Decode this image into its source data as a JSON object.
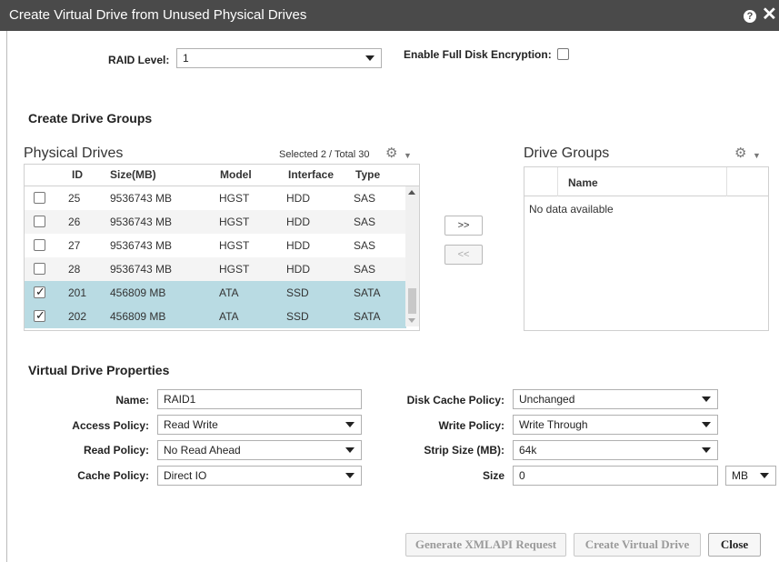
{
  "window": {
    "title": "Create Virtual Drive from Unused Physical Drives",
    "help_icon": "?",
    "close_icon": "✕"
  },
  "raid": {
    "label": "RAID Level:",
    "value": "1"
  },
  "encryption": {
    "label": "Enable Full Disk Encryption:",
    "checked": false
  },
  "create_groups": {
    "title": "Create Drive Groups"
  },
  "physical": {
    "title": "Physical Drives",
    "selected_text": "Selected 2 / Total 30",
    "columns": [
      "ID",
      "Size(MB)",
      "Model",
      "Interface",
      "Type"
    ],
    "rows": [
      {
        "id": "25",
        "size": "9536743 MB",
        "model": "HGST",
        "interface": "HDD",
        "type": "SAS",
        "checked": false
      },
      {
        "id": "26",
        "size": "9536743 MB",
        "model": "HGST",
        "interface": "HDD",
        "type": "SAS",
        "checked": false
      },
      {
        "id": "27",
        "size": "9536743 MB",
        "model": "HGST",
        "interface": "HDD",
        "type": "SAS",
        "checked": false
      },
      {
        "id": "28",
        "size": "9536743 MB",
        "model": "HGST",
        "interface": "HDD",
        "type": "SAS",
        "checked": false
      },
      {
        "id": "201",
        "size": "456809 MB",
        "model": "ATA",
        "interface": "SSD",
        "type": "SATA",
        "checked": true
      },
      {
        "id": "202",
        "size": "456809 MB",
        "model": "ATA",
        "interface": "SSD",
        "type": "SATA",
        "checked": true
      }
    ]
  },
  "move": {
    "add_label": ">>",
    "remove_label": "<<"
  },
  "drive_groups": {
    "title": "Drive Groups",
    "column": "Name",
    "empty_text": "No data available"
  },
  "vd_props": {
    "title": "Virtual Drive Properties",
    "name_label": "Name:",
    "name_value": "RAID1",
    "access_label": "Access Policy:",
    "access_value": "Read Write",
    "read_label": "Read Policy:",
    "read_value": "No Read Ahead",
    "cache_label": "Cache Policy:",
    "cache_value": "Direct IO",
    "disk_cache_label": "Disk Cache Policy:",
    "disk_cache_value": "Unchanged",
    "write_label": "Write Policy:",
    "write_value": "Write Through",
    "strip_label": "Strip Size (MB):",
    "strip_value": "64k",
    "size_label": "Size",
    "size_value": "0",
    "size_unit": "MB"
  },
  "buttons": {
    "xmlapi": "Generate XMLAPI Request",
    "create": "Create Virtual Drive",
    "close": "Close"
  },
  "colors": {
    "titlebar": "#4a4a4a",
    "selected_row": "#b9dbe3"
  }
}
